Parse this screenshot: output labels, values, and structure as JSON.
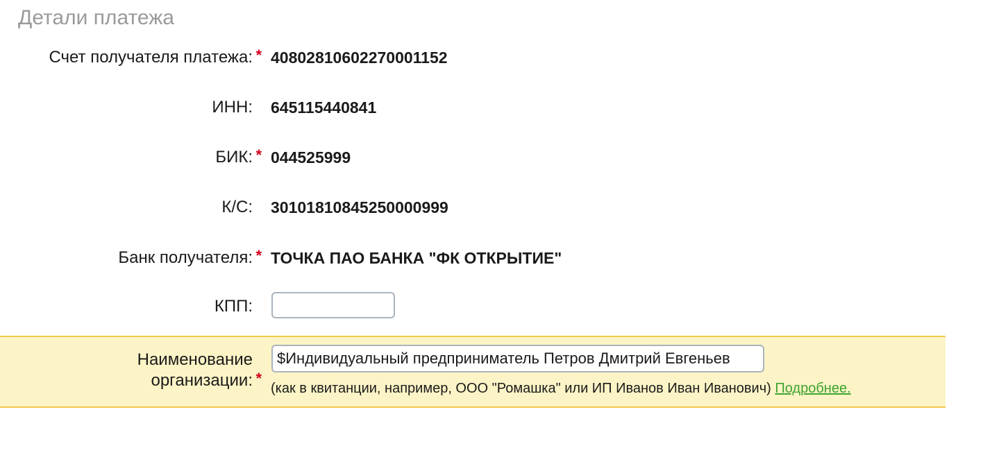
{
  "section": {
    "title": "Детали платежа"
  },
  "fields": {
    "account": {
      "label": "Счет получателя платежа:",
      "required": "*",
      "value": "40802810602270001152"
    },
    "inn": {
      "label": "ИНН:",
      "value": "645115440841"
    },
    "bik": {
      "label": "БИК:",
      "required": "*",
      "value": "044525999"
    },
    "ks": {
      "label": "К/С:",
      "value": "30101810845250000999"
    },
    "bank": {
      "label": "Банк получателя:",
      "required": "*",
      "value": "ТОЧКА ПАО БАНКА \"ФК ОТКРЫТИЕ\""
    },
    "kpp": {
      "label": "КПП:",
      "value": ""
    },
    "org_name": {
      "label_line1": "Наименование",
      "label_line2": "организации:",
      "required": "*",
      "value": "$Индивидуальный предприниматель Петров Дмитрий Евгеньев",
      "hint": "(как в квитанции, например, ООО \"Ромашка\" или ИП Иванов Иван Иванович)",
      "more_link": "Подробнее."
    }
  },
  "colors": {
    "required_star": "#d0021b",
    "highlight_bg": "#fcf4c6",
    "highlight_border": "#f2c94c",
    "link": "#3ea330",
    "title": "#9a9a9a"
  }
}
